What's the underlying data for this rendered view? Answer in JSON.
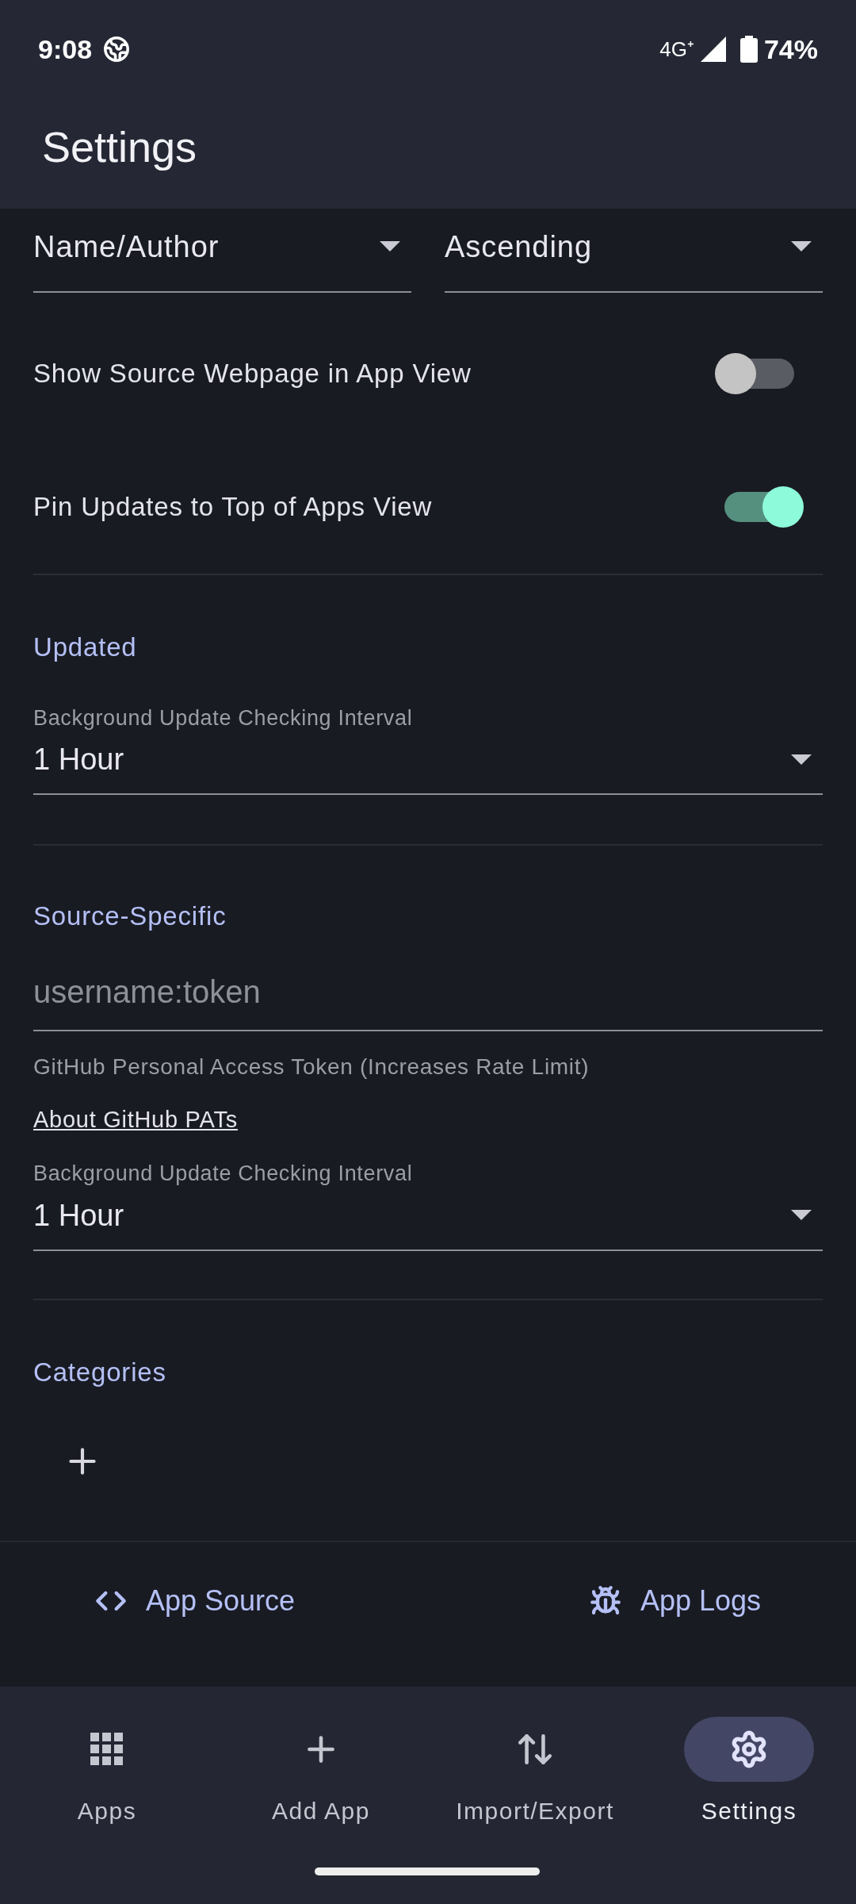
{
  "status_bar": {
    "time": "9:08",
    "network": "4G⁺",
    "battery": "74%"
  },
  "app_bar": {
    "title": "Settings"
  },
  "sort": [
    {
      "value": "Name/Author"
    },
    {
      "value": "Ascending"
    }
  ],
  "toggles": [
    {
      "label": "Show Source Webpage in App View",
      "on": false
    },
    {
      "label": "Pin Updates to Top of Apps View",
      "on": true
    }
  ],
  "updated": {
    "heading": "Updated",
    "interval": {
      "label": "Background Update Checking Interval",
      "value": "1 Hour"
    }
  },
  "source_specific": {
    "heading": "Source-Specific",
    "token": {
      "placeholder": "username:token",
      "helper": "GitHub Personal Access Token (Increases Rate Limit)"
    },
    "link": "About GitHub PATs",
    "interval": {
      "label": "Background Update Checking Interval",
      "value": "1 Hour"
    }
  },
  "categories": {
    "heading": "Categories"
  },
  "footer_links": [
    {
      "label": "App Source",
      "kind": "code"
    },
    {
      "label": "App Logs",
      "kind": "bug"
    }
  ],
  "bottom_nav": [
    {
      "label": "Apps",
      "kind": "apps",
      "selected": false
    },
    {
      "label": "Add App",
      "kind": "add",
      "selected": false
    },
    {
      "label": "Import/Export",
      "kind": "swap",
      "selected": false
    },
    {
      "label": "Settings",
      "kind": "settings",
      "selected": true
    }
  ]
}
